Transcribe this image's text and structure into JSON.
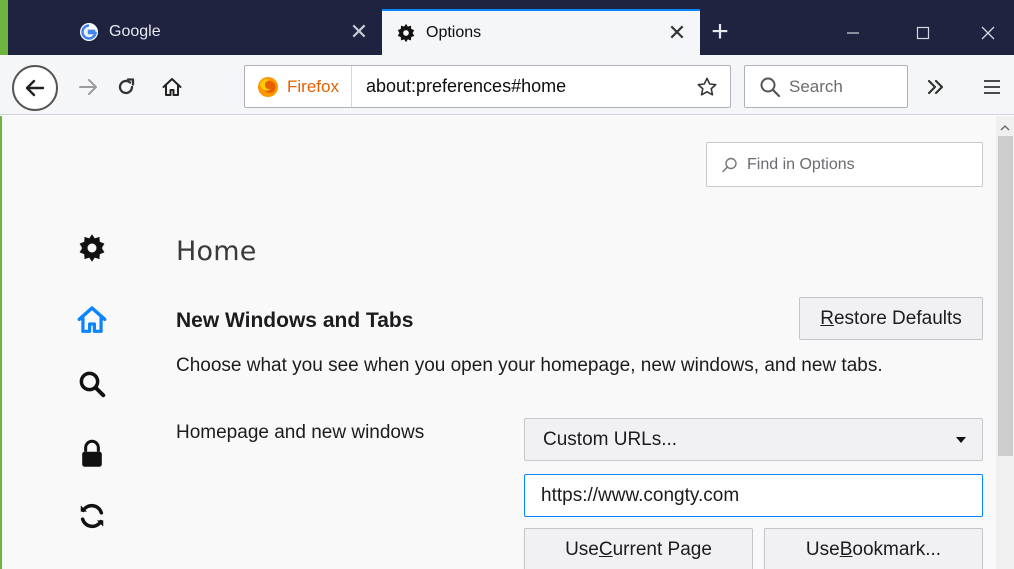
{
  "tabs": [
    {
      "title": "Google",
      "favicon": "google-icon",
      "active": false
    },
    {
      "title": "Options",
      "favicon": "gear-icon",
      "active": true
    }
  ],
  "window_controls": [
    "minimize-icon",
    "maximize-icon",
    "close-icon"
  ],
  "navbar": {
    "identity_label": "Firefox",
    "url": "about:preferences#home",
    "search_placeholder": "Search"
  },
  "content": {
    "find_placeholder": "Find in Options",
    "categories": [
      "gear-icon",
      "home-icon",
      "search-icon",
      "lock-icon",
      "sync-icon"
    ],
    "page_heading": "Home",
    "section_title": "New Windows and Tabs",
    "restore_button": {
      "pre": "",
      "accel": "R",
      "post": "estore Defaults"
    },
    "section_description": "Choose what you see when you open your homepage, new windows, and new tabs.",
    "homepage_label": "Homepage and new windows",
    "homepage_select_value": "Custom URLs...",
    "homepage_url_value": "https://www.congty.com",
    "use_current_button": {
      "pre": "Use ",
      "accel": "C",
      "post": "urrent Page"
    },
    "use_bookmark_button": {
      "pre": "Use ",
      "accel": "B",
      "post": "ookmark..."
    }
  },
  "colors": {
    "tabbar_bg": "#202340",
    "accent_blue": "#0a84ff",
    "green_edge": "#6cb33f",
    "firefox_orange": "#e66000"
  }
}
